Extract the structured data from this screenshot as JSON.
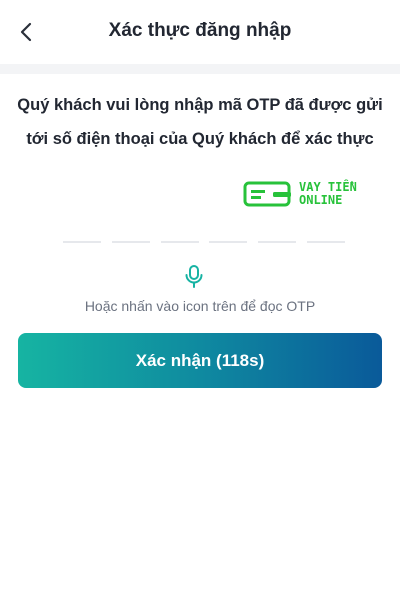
{
  "header": {
    "title": "Xác thực đăng nhập",
    "back_icon": "chevron-left-icon"
  },
  "instruction": {
    "line1": "Quý khách vui lòng nhập mã OTP đã được gửi",
    "line2": "tới số điện thoại của Quý khách để xác thực"
  },
  "watermark": {
    "line1": "VAY TIỀN",
    "line2": "ONLINE",
    "color": "#27c23a"
  },
  "otp": {
    "slots": 6
  },
  "voice": {
    "icon": "microphone-icon",
    "hint": "Hoặc nhấn vào icon trên để đọc OTP"
  },
  "confirm": {
    "label": "Xác nhận (118s)",
    "gradient_start": "#16b4a2",
    "gradient_end": "#0a5a9a"
  }
}
